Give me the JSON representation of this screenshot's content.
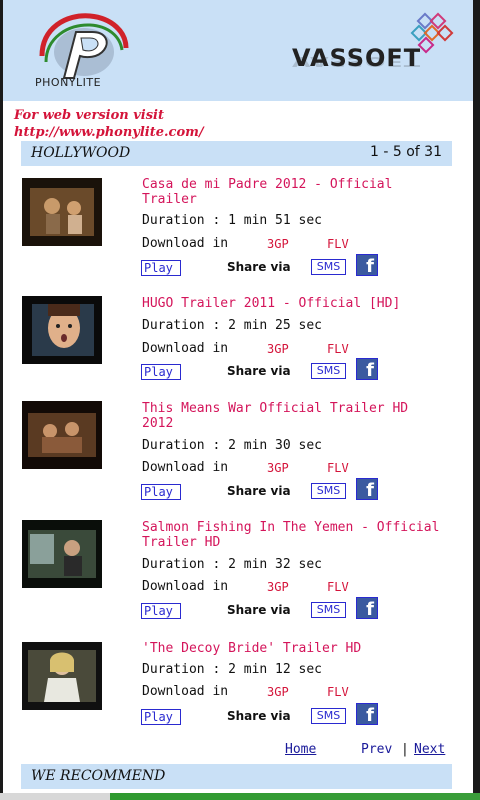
{
  "header": {
    "left_logo_text": "PHONYLITE",
    "right_logo_text": "VASSOFT"
  },
  "notice": {
    "line1": "For web version visit",
    "line2": "http://www.phonylite.com/"
  },
  "section": {
    "title": "HOLLYWOOD",
    "count": "1 - 5 of 31"
  },
  "labels": {
    "download_in": "Download in",
    "format_3gp": "3GP",
    "format_flv": "FLV",
    "play": "Play",
    "share_via": "Share via",
    "sms": "SMS",
    "facebook_glyph": "f"
  },
  "items": [
    {
      "title": "Casa de mi Padre 2012 - Official Trailer",
      "duration": "Duration : 1 min 51 sec"
    },
    {
      "title": "HUGO Trailer 2011 - Official [HD]",
      "duration": "Duration : 2 min 25 sec"
    },
    {
      "title": "This Means War Official Trailer HD 2012",
      "duration": "Duration : 2 min 30 sec"
    },
    {
      "title": "Salmon Fishing In The Yemen - Official Trailer HD",
      "duration": "Duration : 2 min 32 sec"
    },
    {
      "title": "'The Decoy Bride' Trailer HD",
      "duration": "Duration : 2 min 12 sec"
    }
  ],
  "pager": {
    "home": "Home",
    "prev": "Prev",
    "separator": "|",
    "next": "Next"
  },
  "recommend": {
    "title": "WE RECOMMEND"
  },
  "colors": {
    "accent_pink": "#d4145a",
    "header_bg": "#c9e0f6",
    "link_blue": "#2a2ad0"
  }
}
